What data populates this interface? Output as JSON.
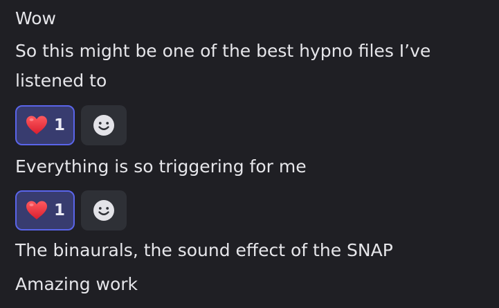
{
  "messages": [
    "Wow",
    "So this might be one of the best hypno files I’ve",
    "listened to",
    "Everything is so triggering for me",
    "The binaurals, the sound effect of the SNAP",
    "Amazing work"
  ],
  "reactions": [
    {
      "emoji": "heart-emoji",
      "count": "1"
    },
    {
      "emoji": "heart-emoji",
      "count": "1"
    }
  ],
  "colors": {
    "background": "#1f1f24",
    "text": "#e6e6ea",
    "reaction_bg": "#383c6f",
    "reaction_border": "#5a65ea",
    "add_reaction_bg": "#2e3036",
    "heart": "#e1333f"
  },
  "icons": {
    "add_reaction": "smiley-face-icon"
  }
}
